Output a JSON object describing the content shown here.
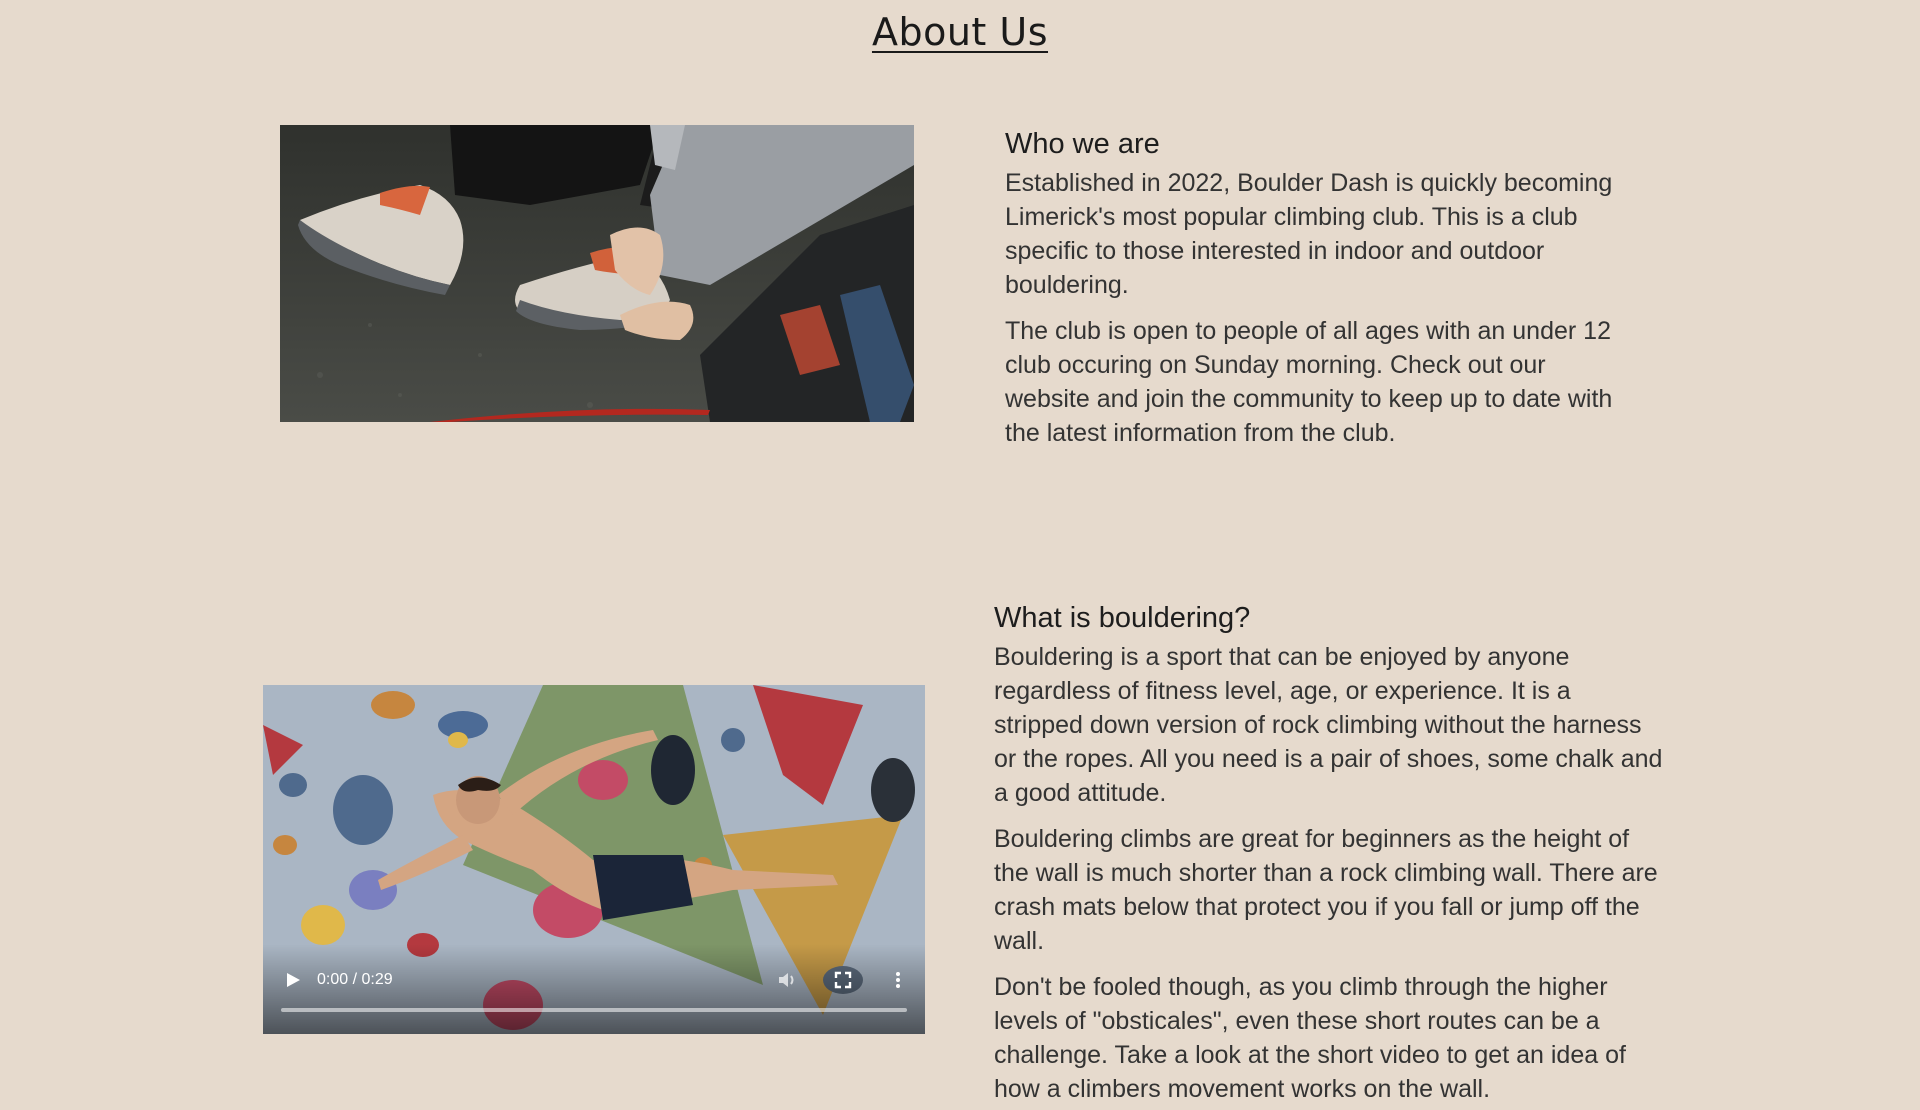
{
  "page": {
    "title": "About Us"
  },
  "who": {
    "heading": "Who we are",
    "paragraphs": [
      "Established in 2022, Boulder Dash is quickly becoming Limerick's most popular climbing club. This is a club specific to those interested in indoor and outdoor bouldering.",
      "The club is open to people of all ages with an under 12 club occuring on Sunday morning. Check out our website and join the community to keep up to date with the latest information from the club."
    ]
  },
  "what": {
    "heading": "What is bouldering?",
    "paragraphs": [
      "Bouldering is a sport that can be enjoyed by anyone regardless of fitness level, age, or experience. It is a stripped down version of rock climbing without the harness or the ropes. All you need is a pair of shoes, some chalk and a good attitude.",
      "Bouldering climbs are great for beginners as the height of the wall is much shorter than a rock climbing wall. There are crash mats below that protect you if you fall or jump off the wall.",
      "Don't be fooled though, as you climb through the higher levels of \"obsticales\", even these short routes can be a challenge. Take a look at the short video to get an idea of how a climbers movement works on the wall."
    ]
  },
  "video": {
    "time": "0:00 / 0:29",
    "progress": 0
  },
  "colors": {
    "background": "#e6dacd",
    "text": "#333333"
  }
}
